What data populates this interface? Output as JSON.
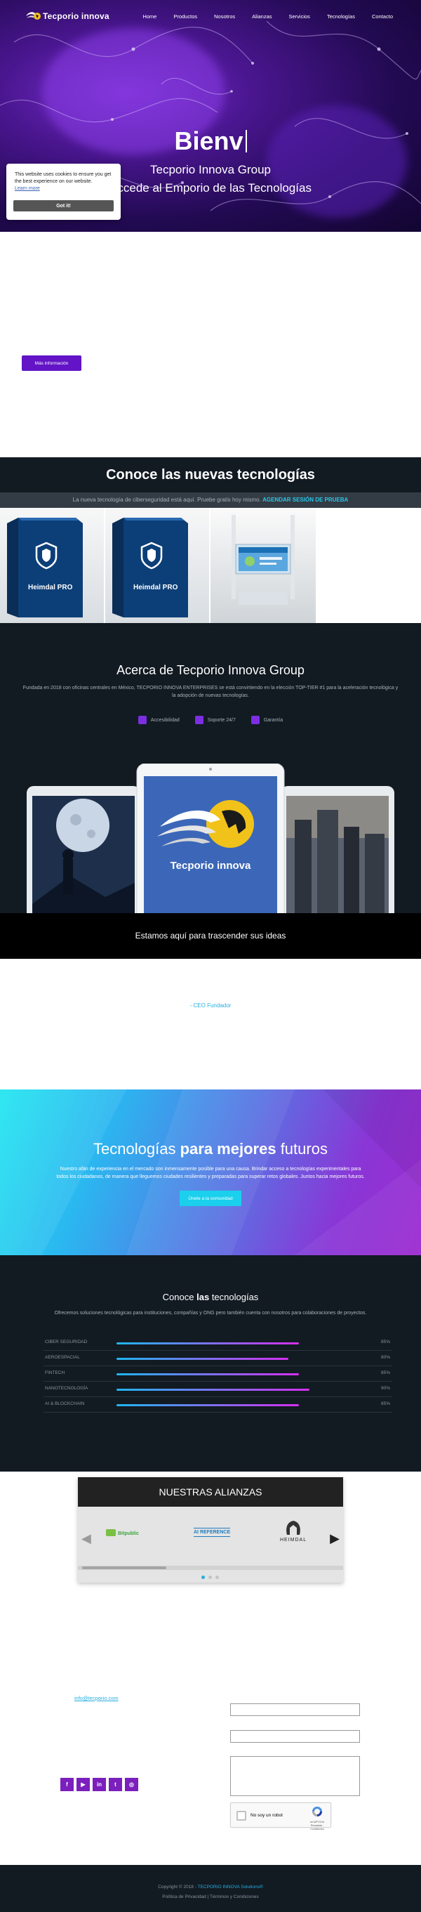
{
  "header": {
    "brand": "Tecporio innova",
    "nav": [
      "Home",
      "Productos",
      "Nosotros",
      "Alianzas",
      "Servicios",
      "Tecnologías",
      "Contacto"
    ]
  },
  "hero": {
    "typed_title": "Bienv",
    "subtitle_1": "Tecporio Innova Group",
    "subtitle_2": "Accede al Emporio de las Tecnologías"
  },
  "cookie": {
    "text": "This website uses cookies to ensure you get the best experience on our website.",
    "learn_more": "Learn more",
    "button": "Got it!"
  },
  "intro": {
    "button": "Más información"
  },
  "new_tech": {
    "title": "Conoce las nuevas tecnologías",
    "promo_text": "La nueva tecnología de ciberseguridad está aquí. Pruebe gratis hoy mismo.",
    "promo_link": "AGENDAR SESIÓN DE PRUEBA",
    "products": [
      {
        "label": "Heimdal PRO"
      },
      {
        "label": "Heimdal PRO"
      }
    ]
  },
  "about": {
    "title": "Acerca de Tecporio Innova Group",
    "description": "Fundada en 2018 con oficinas centrales en México, TECPORIO INNOVA ENTERPRISES se está convirtiendo en la elección TOP-TIER #1 para la aceleración tecnológica y la adopción de nuevas tecnologías.",
    "features": [
      "Accesibilidad",
      "Soporte 24/7",
      "Garantía"
    ],
    "device_brand": "Tecporio innova",
    "tagline": "Estamos aquí para trascender sus ideas"
  },
  "ceo": {
    "text": "- CEO Fundador"
  },
  "future": {
    "title_pre": "Tecnologías",
    "title_bold": "para mejores",
    "title_post": "futuros",
    "text": "Nuestro afán de experiencia en el mercado son inmensamente posible para una causa. Brindar acceso a tecnologías experimentales para todos los ciudadanos, de manera que lleguemos ciudades resilientes y preparadas para superar retos globales. Juntos hacia mejores futuros.",
    "button": "Únete a la comunidad"
  },
  "skills": {
    "title_pre": "Conoce",
    "title_bold": "las",
    "title_post": "tecnologías",
    "subtitle": "Ofrecemos soluciones tecnológicas para instituciones, compañías y ONG pero también cuenta con nosotros para colaboraciones de proyectos.",
    "items": [
      {
        "label": "CIBER SEGURIDAD",
        "value": 85,
        "display": "85%"
      },
      {
        "label": "AEROESPACIAL",
        "value": 80,
        "display": "80%"
      },
      {
        "label": "FINTECH",
        "value": 85,
        "display": "85%"
      },
      {
        "label": "NANOTECNOLOGÍA",
        "value": 90,
        "display": "90%"
      },
      {
        "label": "AI & BLOCKCHAIN",
        "value": 85,
        "display": "85%"
      }
    ]
  },
  "alliances": {
    "title": "NUESTRAS ALIANZAS",
    "logos": [
      "Bitpublic",
      "AI REFERENCE",
      "HEIMDAL"
    ]
  },
  "contact": {
    "email": "info@tecporio.com",
    "socials": [
      "f",
      "▶",
      "in",
      "t",
      "◎"
    ],
    "captcha_text": "No soy un robot",
    "captcha_brand": "reCAPTCHA",
    "captcha_terms": "Privacidad - Condiciones"
  },
  "footer": {
    "copyright_pre": "Copyright © 2018 -",
    "copyright_link": "TECPORIO INNOVA Solutions®",
    "legal": "Política de Privacidad | Términos y Condiciones"
  },
  "colors": {
    "accent": "#6214c6",
    "cyan": "#27aee0",
    "dark": "#121a22"
  }
}
